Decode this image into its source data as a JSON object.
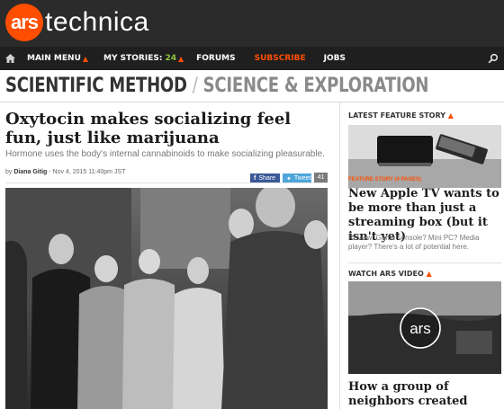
{
  "brand": {
    "logo_mark": "ars",
    "logo_word": "technica",
    "accent_color": "#ff4e00"
  },
  "nav": {
    "home_icon": "home-icon",
    "items": [
      {
        "label": "MAIN MENU",
        "caret": "▲"
      },
      {
        "label": "MY STORIES:",
        "count": "24",
        "caret": "▲"
      },
      {
        "label": "FORUMS"
      },
      {
        "label": "SUBSCRIBE"
      },
      {
        "label": "JOBS"
      }
    ],
    "search_icon": "search-icon"
  },
  "section": {
    "main": "SCIENTIFIC METHOD",
    "separator": "/",
    "sub": "SCIENCE & EXPLORATION"
  },
  "article": {
    "headline": "Oxytocin makes socializing feel fun, just like marijuana",
    "dek": "Hormone uses the body's internal cannabinoids to make socializing pleasurable.",
    "byline_prefix": "by",
    "author": "Diana Gitig",
    "date": "- Nov 4, 2015 11:40pm JST",
    "share_facebook": "Share",
    "share_twitter": "Tweet",
    "comment_count": "41"
  },
  "sidebar": {
    "latest_label": "LATEST FEATURE STORY",
    "feature_tag": "FEATURE STORY (4 PAGES)",
    "feature_title": "New Apple TV wants to be more than just a streaming box (but it isn't yet)",
    "feature_dek": "Review: Game console? Mini PC? Media player? There's a lot of potential here.",
    "video_label": "WATCH ARS VIDEO",
    "video_logo": "ars",
    "video_title": "How a group of neighbors created their own Internet",
    "label_caret": "▲"
  }
}
